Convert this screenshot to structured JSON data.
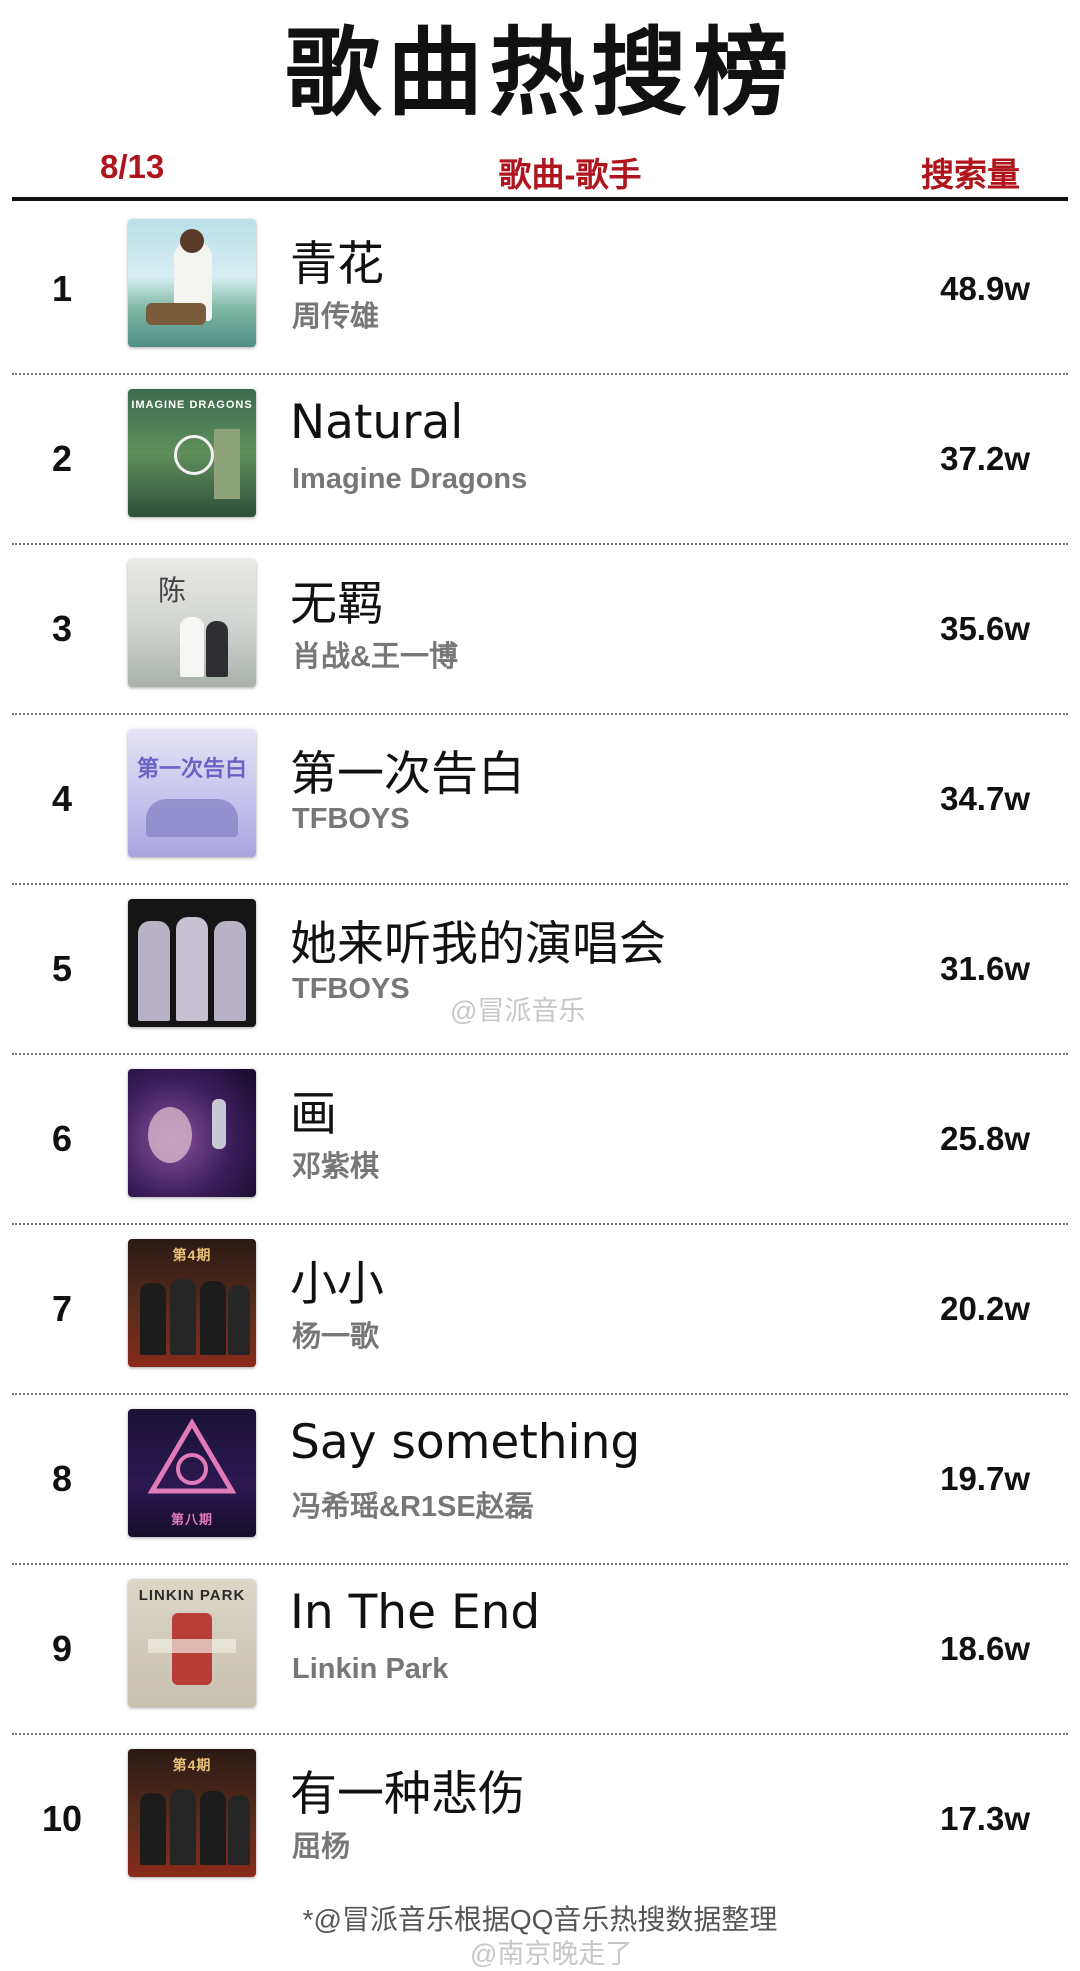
{
  "title": "歌曲热搜榜",
  "header": {
    "date": "8/13",
    "song_artist": "歌曲-歌手",
    "search_volume": "搜索量"
  },
  "items": [
    {
      "rank": "1",
      "song": "青花",
      "artist": "周传雄",
      "count": "48.9w"
    },
    {
      "rank": "2",
      "song": "Natural",
      "artist": "Imagine Dragons",
      "count": "37.2w",
      "cover_text": "IMAGINE DRAGONS"
    },
    {
      "rank": "3",
      "song": "无羁",
      "artist": "肖战&王一博",
      "count": "35.6w"
    },
    {
      "rank": "4",
      "song": "第一次告白",
      "artist": "TFBOYS",
      "count": "34.7w",
      "cover_text": "第一次告白"
    },
    {
      "rank": "5",
      "song": "她来听我的演唱会",
      "artist": "TFBOYS",
      "count": "31.6w"
    },
    {
      "rank": "6",
      "song": "画",
      "artist": "邓紫棋",
      "count": "25.8w"
    },
    {
      "rank": "7",
      "song": "小小",
      "artist": "杨一歌",
      "count": "20.2w",
      "cover_text": "第4期"
    },
    {
      "rank": "8",
      "song": "Say something",
      "artist": "冯希瑶&R1SE赵磊",
      "count": "19.7w",
      "cover_text": "第八期"
    },
    {
      "rank": "9",
      "song": "In The End",
      "artist": "Linkin Park",
      "count": "18.6w",
      "cover_text": "LINKIN PARK"
    },
    {
      "rank": "10",
      "song": "有一种悲伤",
      "artist": "屈杨",
      "count": "17.3w",
      "cover_text": "第4期"
    }
  ],
  "watermark_1": "@冒派音乐",
  "watermark_2": "@南京晚走了",
  "footer": "*@冒派音乐根据QQ音乐热搜数据整理",
  "colors": {
    "accent": "#b0141c",
    "text": "#111111",
    "muted": "#777777"
  }
}
